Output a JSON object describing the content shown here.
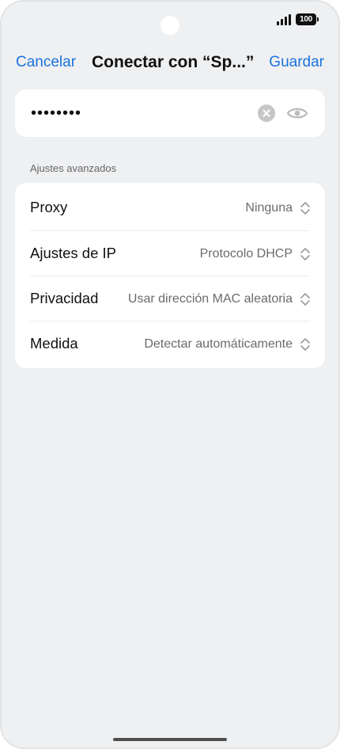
{
  "status_bar": {
    "battery_level": "100",
    "signal_icon": "signal-bars-icon",
    "battery_icon": "battery-icon"
  },
  "nav": {
    "cancel_label": "Cancelar",
    "title": "Conectar con “Sp...”",
    "save_label": "Guardar"
  },
  "password": {
    "value": "••••••••",
    "clear_icon": "clear-icon",
    "reveal_icon": "eye-icon"
  },
  "advanced": {
    "section_label": "Ajustes avanzados",
    "rows": [
      {
        "label": "Proxy",
        "value": "Ninguna"
      },
      {
        "label": "Ajustes de IP",
        "value": "Protocolo DHCP"
      },
      {
        "label": "Privacidad",
        "value": "Usar dirección MAC aleatoria"
      },
      {
        "label": "Medida",
        "value": "Detectar automáticamente"
      }
    ]
  },
  "colors": {
    "accent": "#1a73e0",
    "background": "#eff0f2",
    "card": "#ffffff"
  }
}
